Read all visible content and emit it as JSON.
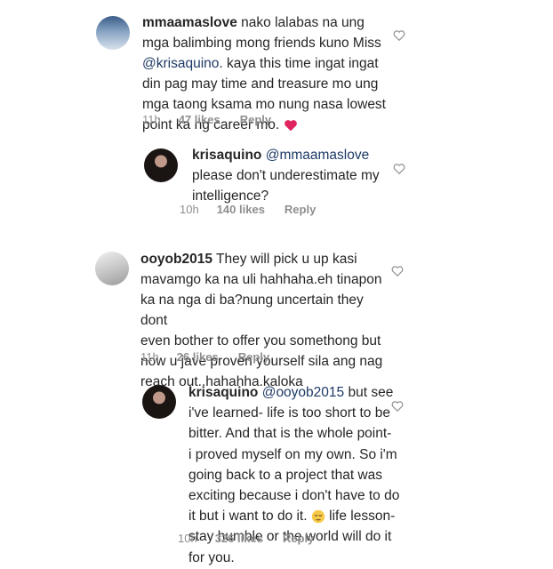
{
  "comments": [
    {
      "username": "mmaamaslove",
      "lines": [
        "nako lalabas na ung",
        "mga balimbing mong friends kuno Miss",
        "@krisaquino",
        ". kaya this time ingat ingat",
        "din pag may time and treasure mo ung",
        "mga taong ksama mo nung nasa lowest",
        "point ka ng career mo."
      ],
      "time": "11h",
      "likes": "47 likes",
      "reply": "Reply"
    },
    {
      "username": "krisaquino",
      "mention": "@mmaamaslove",
      "lines": [
        "please don't underestimate my",
        "intelligence?"
      ],
      "time": "10h",
      "likes": "140 likes",
      "reply": "Reply"
    },
    {
      "username": "ooyob2015",
      "lines": [
        "They will pick u up kasi",
        "mavamgo ka na uli hahhaha.eh tinapon",
        "ka na nga di ba?nung uncertain they dont",
        "even bother to offer you somethong but",
        "now u jave proven yourself sila ang nag",
        "reach out..hahahha.kaloka"
      ],
      "time": "11h",
      "likes": "26 likes",
      "reply": "Reply"
    },
    {
      "username": "krisaquino",
      "mention": "@ooyob2015",
      "lines": [
        "but see",
        "i've learned- life is too short to be",
        "bitter. And that is the whole point-",
        "i proved myself on my own. So i'm",
        "going back to a project that was",
        "exciting because i don't have to do",
        "it but i want to do it.",
        "life lesson-",
        "stay humble or the world will do it",
        "for you."
      ],
      "time": "10h",
      "likes": "326 likes",
      "reply": "Reply"
    }
  ]
}
